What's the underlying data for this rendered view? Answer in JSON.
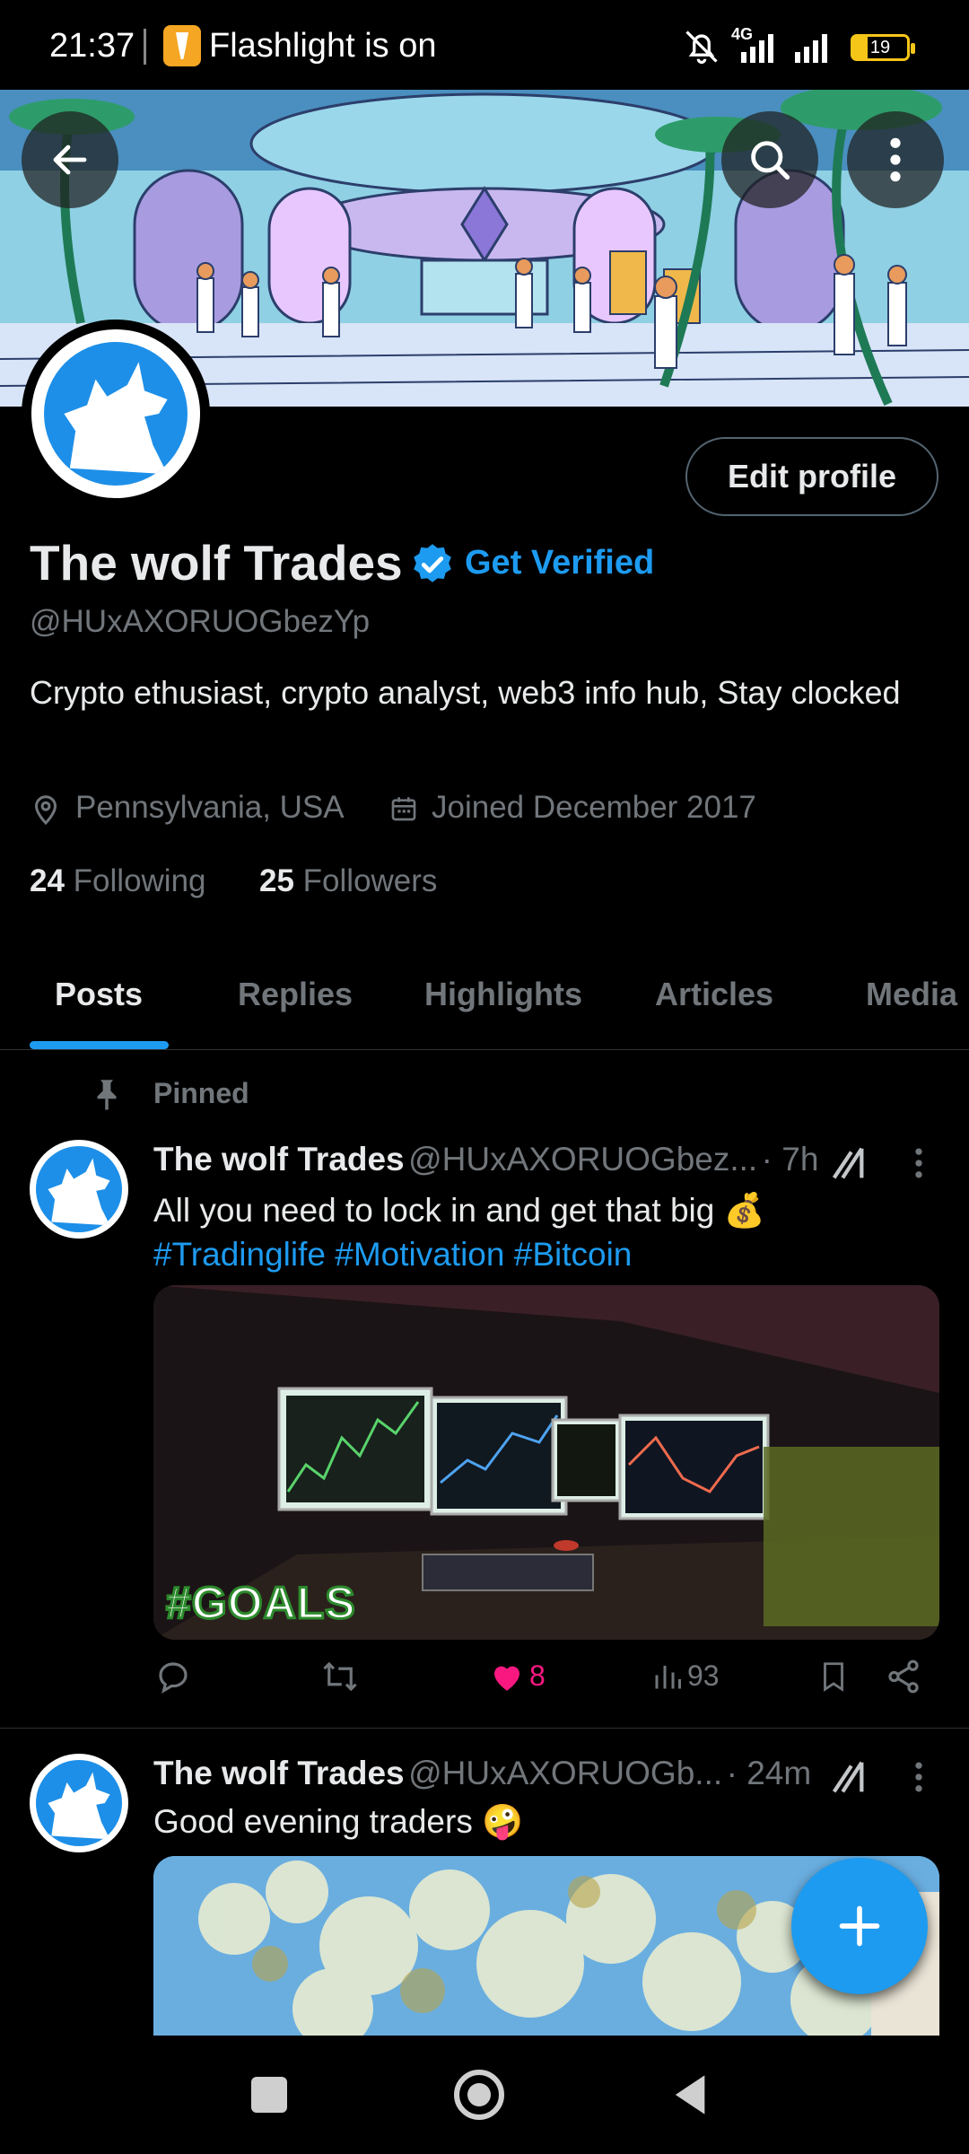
{
  "status_bar": {
    "time": "21:37",
    "notification": "Flashlight is on",
    "network": "4G",
    "battery": "19",
    "icons": [
      "flashlight-icon",
      "bell-muted-icon",
      "signal-icon",
      "signal-icon",
      "battery-icon"
    ]
  },
  "header": {
    "back_icon": "arrow-left-icon",
    "search_icon": "search-icon",
    "more_icon": "more-vertical-icon"
  },
  "profile": {
    "name": "The wolf Trades",
    "get_verified": "Get Verified",
    "handle": "@HUxAXORUOGbezYp",
    "bio": "Crypto ethusiast, crypto analyst, web3 info hub,   Stay clocked",
    "location": "Pennsylvania, USA",
    "joined": "Joined December 2017",
    "following_count": "24",
    "following_label": "Following",
    "followers_count": "25",
    "followers_label": "Followers",
    "edit_profile": "Edit profile"
  },
  "tabs": [
    {
      "label": "Posts",
      "active": true
    },
    {
      "label": "Replies",
      "active": false
    },
    {
      "label": "Highlights",
      "active": false
    },
    {
      "label": "Articles",
      "active": false
    },
    {
      "label": "Media",
      "active": false
    }
  ],
  "posts": [
    {
      "pinned_label": "Pinned",
      "name": "The wolf Trades",
      "handle": "@HUxAXORUOGbez...",
      "time": "· 7h",
      "text": "All you need to lock in and get that big 💰",
      "hashtags": [
        "#Tradinglife",
        "#Motivation",
        "#Bitcoin"
      ],
      "image_overlay_text": "#GOALS",
      "likes": "8",
      "views": "93"
    },
    {
      "name": "The wolf Trades",
      "handle": "@HUxAXORUOGb...",
      "time": "· 24m",
      "text": "Good evening traders 🤪"
    }
  ],
  "colors": {
    "accent": "#1d9bf0",
    "like": "#f91880",
    "muted": "#71767b",
    "background": "#000000"
  }
}
